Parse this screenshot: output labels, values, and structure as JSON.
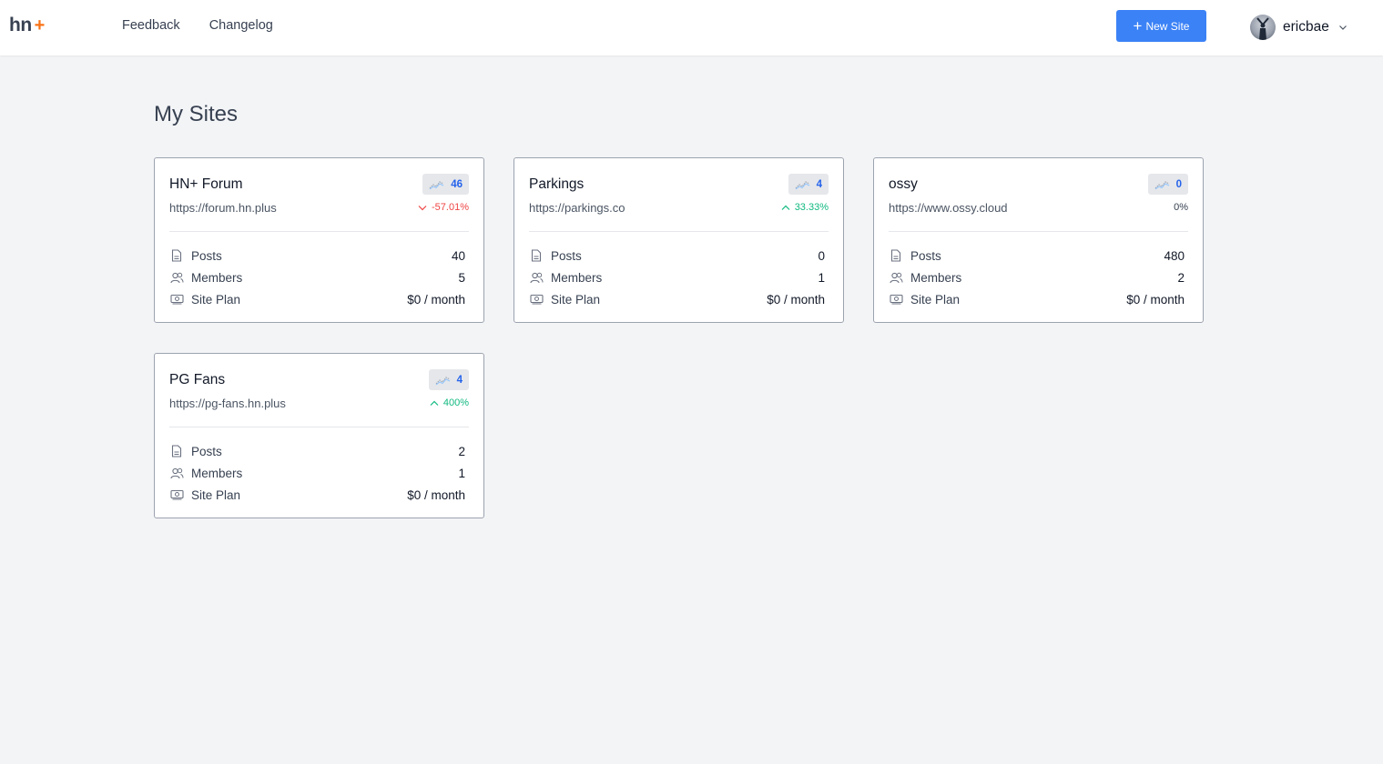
{
  "brand": {
    "logo_text": "hn",
    "logo_plus": "+",
    "accent": "#f97316",
    "primary": "#3b82f6"
  },
  "nav": {
    "items": [
      {
        "label": "Feedback"
      },
      {
        "label": "Changelog"
      }
    ]
  },
  "new_site_button": {
    "label": "New Site",
    "icon": "plus-icon"
  },
  "user": {
    "name": "ericbae",
    "avatar_icon": "avatar",
    "menu_icon": "chevron-down-icon"
  },
  "page": {
    "title": "My Sites"
  },
  "stat_labels": {
    "posts": "Posts",
    "members": "Members",
    "plan": "Site Plan"
  },
  "sites": [
    {
      "name": "HN+ Forum",
      "url": "https://forum.hn.plus",
      "visits": "46",
      "change": "-57.01%",
      "trend": "down",
      "posts": "40",
      "members": "5",
      "plan": "$0 / month"
    },
    {
      "name": "Parkings",
      "url": "https://parkings.co",
      "visits": "4",
      "change": "33.33%",
      "trend": "up",
      "posts": "0",
      "members": "1",
      "plan": "$0 / month"
    },
    {
      "name": "ossy",
      "url": "https://www.ossy.cloud",
      "visits": "0",
      "change": "0%",
      "trend": "flat",
      "posts": "480",
      "members": "2",
      "plan": "$0 / month"
    },
    {
      "name": "PG Fans",
      "url": "https://pg-fans.hn.plus",
      "visits": "4",
      "change": "400%",
      "trend": "up",
      "posts": "2",
      "members": "1",
      "plan": "$0 / month"
    }
  ]
}
